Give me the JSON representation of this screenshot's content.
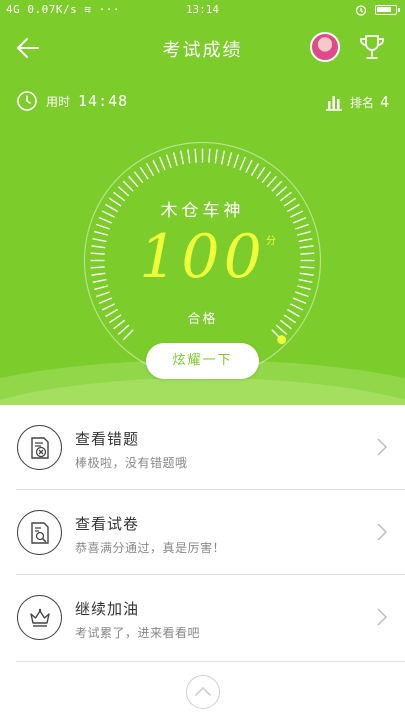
{
  "status_bar": {
    "left": "4G 0.07K/s ≋ ···",
    "time": "13:14"
  },
  "header": {
    "title": "考试成绩"
  },
  "info": {
    "time_label": "用时",
    "time_value": "14:48",
    "rank_label": "排名",
    "rank_value": "4"
  },
  "result": {
    "name": "木仓车神",
    "score": "100",
    "score_unit": "分",
    "status": "合格",
    "gauge_fraction": 1.0
  },
  "show_button": "炫耀一下",
  "list": [
    {
      "title": "查看错题",
      "subtitle": "棒极啦，没有错题哦",
      "icon": "wrong-question-icon"
    },
    {
      "title": "查看试卷",
      "subtitle": "恭喜满分通过，真是厉害！",
      "icon": "paper-search-icon"
    },
    {
      "title": "继续加油",
      "subtitle": "考试累了，进来看看吧",
      "icon": "crown-icon"
    }
  ],
  "colors": {
    "primary_green": "#7ccc2b",
    "score_yellow": "#eeff3a"
  }
}
